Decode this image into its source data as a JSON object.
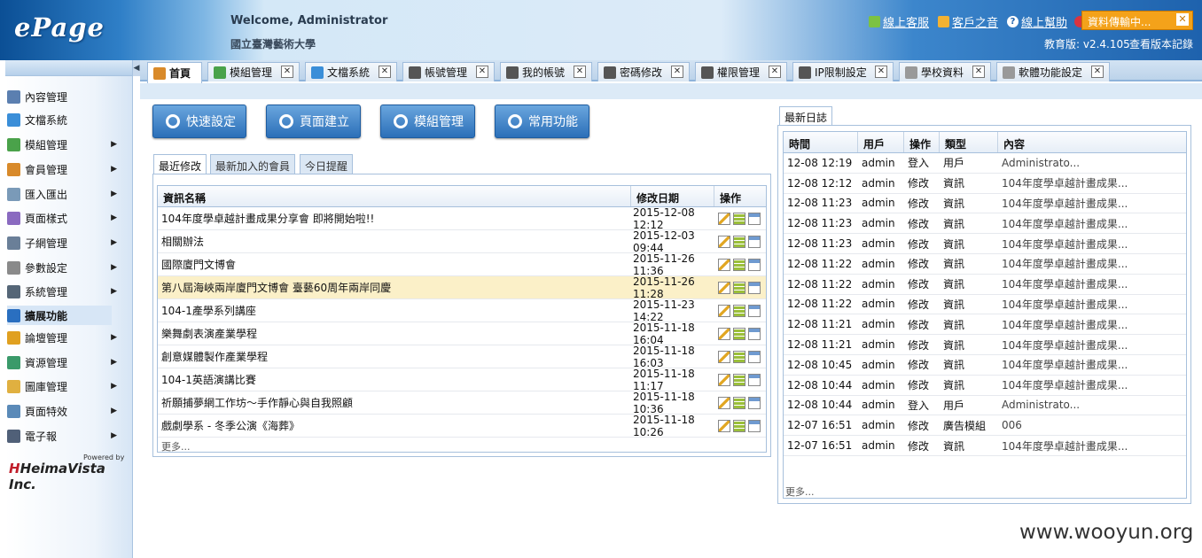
{
  "header": {
    "logo": "ePage",
    "welcome": "Welcome, Administrator",
    "school": "國立臺灣藝術大學",
    "links": [
      {
        "label": "線上客服",
        "icon": "headset-icon"
      },
      {
        "label": "客戶之音",
        "icon": "feedback-icon"
      },
      {
        "label": "線上幫助",
        "icon": "help-icon"
      }
    ],
    "transfer_status": "資料傳輸中...",
    "version": "教育版: v2.4.105",
    "version_link": "查看版本記錄"
  },
  "sidebar": {
    "items": [
      {
        "label": "內容管理",
        "icon": "content-icon",
        "arrow": false
      },
      {
        "label": "文檔系統",
        "icon": "document-icon",
        "arrow": false
      },
      {
        "label": "模組管理",
        "icon": "module-icon",
        "arrow": true
      },
      {
        "label": "會員管理",
        "icon": "members-icon",
        "arrow": true
      },
      {
        "label": "匯入匯出",
        "icon": "import-export-icon",
        "arrow": true
      },
      {
        "label": "頁面樣式",
        "icon": "page-style-icon",
        "arrow": true
      },
      {
        "label": "子網管理",
        "icon": "subnet-icon",
        "arrow": true
      },
      {
        "label": "參數設定",
        "icon": "settings-icon",
        "arrow": true
      },
      {
        "label": "系統管理",
        "icon": "system-icon",
        "arrow": true
      },
      {
        "label": "擴展功能",
        "icon": "extension-icon",
        "arrow": false,
        "active": true
      },
      {
        "label": "論壇管理",
        "icon": "forum-icon",
        "arrow": true
      },
      {
        "label": "資源管理",
        "icon": "resource-icon",
        "arrow": true
      },
      {
        "label": "圖庫管理",
        "icon": "gallery-icon",
        "arrow": true
      },
      {
        "label": "頁面特效",
        "icon": "effects-icon",
        "arrow": true
      },
      {
        "label": "電子報",
        "icon": "newsletter-icon",
        "arrow": true
      }
    ],
    "powered_by": "Powered by",
    "vendor": "HeimaVista Inc."
  },
  "tabs": [
    {
      "label": "首頁",
      "icon": "home-icon",
      "active": true,
      "closable": false
    },
    {
      "label": "模組管理",
      "icon": "module-icon",
      "closable": true
    },
    {
      "label": "文檔系統",
      "icon": "document-icon",
      "closable": true
    },
    {
      "label": "帳號管理",
      "icon": "account-icon",
      "closable": true
    },
    {
      "label": "我的帳號",
      "icon": "account-icon",
      "closable": true
    },
    {
      "label": "密碼修改",
      "icon": "account-icon",
      "closable": true
    },
    {
      "label": "權限管理",
      "icon": "account-icon",
      "closable": true
    },
    {
      "label": "IP限制設定",
      "icon": "account-icon",
      "closable": true
    },
    {
      "label": "學校資料",
      "icon": "gear-icon",
      "closable": true
    },
    {
      "label": "軟體功能設定",
      "icon": "gear-icon",
      "closable": true
    }
  ],
  "quick_buttons": [
    "快速設定",
    "頁面建立",
    "模組管理",
    "常用功能"
  ],
  "subtabs": [
    "最近修改",
    "最新加入的會員",
    "今日提醒"
  ],
  "recent": {
    "headers": [
      "資訊名稱",
      "修改日期",
      "操作"
    ],
    "rows": [
      {
        "name": "104年度學卓越計畫成果分享會 即將開始啦!!",
        "date": "2015-12-08 12:12"
      },
      {
        "name": "相關辦法",
        "date": "2015-12-03 09:44"
      },
      {
        "name": "國際廈門文博會",
        "date": "2015-11-26 11:36"
      },
      {
        "name": "第八屆海峽兩岸廈門文博會 臺藝60周年兩岸同慶",
        "date": "2015-11-26 11:28"
      },
      {
        "name": "104-1產學系列講座",
        "date": "2015-11-23 14:22"
      },
      {
        "name": "樂舞劇表演產業學程",
        "date": "2015-11-18 16:04"
      },
      {
        "name": "創意媒體製作產業學程",
        "date": "2015-11-18 16:03"
      },
      {
        "name": "104-1英語演講比賽",
        "date": "2015-11-18 11:17"
      },
      {
        "name": "祈願捕夢網工作坊～手作靜心與自我照顧",
        "date": "2015-11-18 10:36"
      },
      {
        "name": "戲劇學系 - 冬季公演《海葬》",
        "date": "2015-11-18 10:26"
      }
    ],
    "more": "更多..."
  },
  "log": {
    "tab": "最新日誌",
    "headers": [
      "時間",
      "用戶",
      "操作",
      "類型",
      "內容"
    ],
    "rows": [
      [
        "12-08 12:19",
        "admin",
        "登入",
        "用戶",
        "Administrato..."
      ],
      [
        "12-08 12:12",
        "admin",
        "修改",
        "資訊",
        "104年度學卓越計畫成果..."
      ],
      [
        "12-08 11:23",
        "admin",
        "修改",
        "資訊",
        "104年度學卓越計畫成果..."
      ],
      [
        "12-08 11:23",
        "admin",
        "修改",
        "資訊",
        "104年度學卓越計畫成果..."
      ],
      [
        "12-08 11:23",
        "admin",
        "修改",
        "資訊",
        "104年度學卓越計畫成果..."
      ],
      [
        "12-08 11:22",
        "admin",
        "修改",
        "資訊",
        "104年度學卓越計畫成果..."
      ],
      [
        "12-08 11:22",
        "admin",
        "修改",
        "資訊",
        "104年度學卓越計畫成果..."
      ],
      [
        "12-08 11:22",
        "admin",
        "修改",
        "資訊",
        "104年度學卓越計畫成果..."
      ],
      [
        "12-08 11:21",
        "admin",
        "修改",
        "資訊",
        "104年度學卓越計畫成果..."
      ],
      [
        "12-08 11:21",
        "admin",
        "修改",
        "資訊",
        "104年度學卓越計畫成果..."
      ],
      [
        "12-08 10:45",
        "admin",
        "修改",
        "資訊",
        "104年度學卓越計畫成果..."
      ],
      [
        "12-08 10:44",
        "admin",
        "修改",
        "資訊",
        "104年度學卓越計畫成果..."
      ],
      [
        "12-08 10:44",
        "admin",
        "登入",
        "用戶",
        "Administrato..."
      ],
      [
        "12-07 16:51",
        "admin",
        "修改",
        "廣告模組",
        "006"
      ],
      [
        "12-07 16:51",
        "admin",
        "修改",
        "資訊",
        "104年度學卓越計畫成果..."
      ]
    ],
    "more": "更多..."
  },
  "watermark": "www.wooyun.org",
  "colors": {
    "accent": "#2b6fb8",
    "highlight_row": "#fbf0c8",
    "transfer": "#f4a21a"
  }
}
